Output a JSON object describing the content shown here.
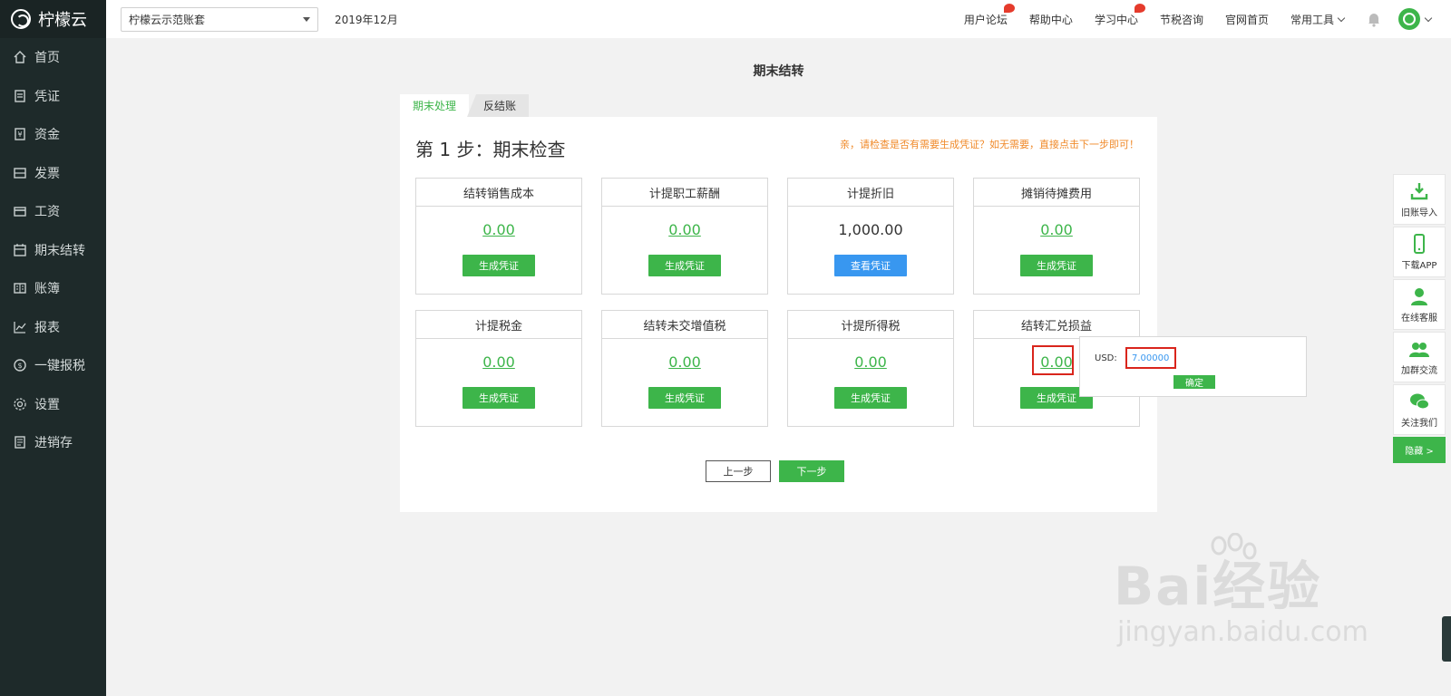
{
  "brand": {
    "name": "柠檬云"
  },
  "sidebar": {
    "items": [
      {
        "label": "首页",
        "icon": "home-icon"
      },
      {
        "label": "凭证",
        "icon": "voucher-icon"
      },
      {
        "label": "资金",
        "icon": "fund-icon"
      },
      {
        "label": "发票",
        "icon": "invoice-icon"
      },
      {
        "label": "工资",
        "icon": "salary-icon"
      },
      {
        "label": "期末结转",
        "icon": "calendar-icon"
      },
      {
        "label": "账簿",
        "icon": "ledger-icon"
      },
      {
        "label": "报表",
        "icon": "chart-icon"
      },
      {
        "label": "一键报税",
        "icon": "tax-icon"
      },
      {
        "label": "设置",
        "icon": "gear-icon"
      },
      {
        "label": "进销存",
        "icon": "inventory-icon"
      }
    ]
  },
  "topbar": {
    "account": "柠檬云示范账套",
    "period": "2019年12月",
    "links": [
      "用户论坛",
      "帮助中心",
      "学习中心",
      "节税咨询",
      "官网首页",
      "常用工具"
    ]
  },
  "page": {
    "title": "期末结转"
  },
  "tabs": [
    "期末处理",
    "反结账"
  ],
  "step": {
    "title": "第 1 步：期末检查",
    "hint": "亲，请检查是否有需要生成凭证？如无需要，直接点击下一步即可！"
  },
  "cards": [
    {
      "title": "结转销售成本",
      "amount": "0.00",
      "button": "生成凭证"
    },
    {
      "title": "计提职工薪酬",
      "amount": "0.00",
      "button": "生成凭证"
    },
    {
      "title": "计提折旧",
      "amount": "1,000.00",
      "button": "查看凭证"
    },
    {
      "title": "摊销待摊费用",
      "amount": "0.00",
      "button": "生成凭证"
    },
    {
      "title": "计提税金",
      "amount": "0.00",
      "button": "生成凭证"
    },
    {
      "title": "结转未交增值税",
      "amount": "0.00",
      "button": "生成凭证"
    },
    {
      "title": "计提所得税",
      "amount": "0.00",
      "button": "生成凭证"
    },
    {
      "title": "结转汇兑损益",
      "amount": "0.00",
      "button": "生成凭证"
    }
  ],
  "nav_buttons": {
    "prev": "上一步",
    "next": "下一步"
  },
  "popover": {
    "label": "USD:",
    "value": "7.00000",
    "ok": "确定"
  },
  "float_bar": [
    "旧账导入",
    "下载APP",
    "在线客服",
    "加群交流",
    "关注我们"
  ],
  "float_hide": "隐藏 >",
  "watermark": {
    "main": "Bai经验",
    "sub": "jingyan.baidu.com"
  },
  "colors": {
    "brand_green": "#3db54a",
    "link_blue": "#3897f0",
    "hint_orange": "#f08a2a",
    "highlight_red": "#d9251c",
    "sidebar_bg": "#1e2a2a"
  }
}
